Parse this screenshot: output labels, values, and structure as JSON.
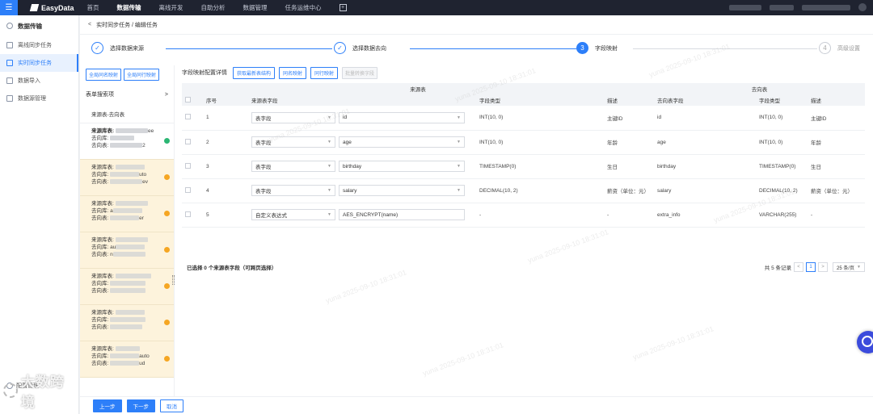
{
  "topbar": {
    "logo": "EasyData",
    "nav": [
      "首页",
      "数据传输",
      "离线开发",
      "自助分析",
      "数据管理",
      "任务运维中心"
    ],
    "active_nav": "数据传输"
  },
  "sidebar": {
    "title": "数据传输",
    "items": [
      {
        "label": "离线同步任务"
      },
      {
        "label": "实时同步任务"
      },
      {
        "label": "数据导入"
      },
      {
        "label": "数据源管理"
      }
    ],
    "bottom": "配置管理"
  },
  "watermark_logo": "大数跨境",
  "watermark_text": "yuna 2025-09-10 18:31:01",
  "breadcrumb": {
    "back": "<",
    "text": "实时同步任务 / 编辑任务"
  },
  "steps": [
    {
      "num": "✓",
      "label": "选择数据来源",
      "state": "done"
    },
    {
      "num": "✓",
      "label": "选择数据去向",
      "state": "done"
    },
    {
      "num": "3",
      "label": "字段映射",
      "state": "current"
    },
    {
      "num": "4",
      "label": "高级设置",
      "state": "todo"
    }
  ],
  "left_panel": {
    "btn_all_same_name": "全局同名映射",
    "btn_all_same_row": "全局同行映射",
    "search_label": "表单搜索项",
    "search_arrow": ">",
    "list_header": "来源表-去向表",
    "cards": [
      {
        "source": "来源库表:",
        "target_lib": "去向库:",
        "target_tbl": "去向表:",
        "tail1": "ee",
        "tail2": "2",
        "status": "ok"
      },
      {
        "source": "来源库表:",
        "target_lib": "去向库:",
        "target_tbl": "去向表:",
        "tail1": "uto",
        "tail2": "ev",
        "status": "warn"
      },
      {
        "source": "来源库表:",
        "target_lib": "去向库:",
        "target_tbl": "去向表:",
        "tail1": "a",
        "tail2": "er",
        "status": "warn"
      },
      {
        "source": "来源库表:",
        "target_lib": "去向库:",
        "target_tbl": "去向表:",
        "tail1": "au",
        "tail2": "n",
        "status": "warn"
      },
      {
        "source": "来源库表:",
        "target_lib": "去向库:",
        "target_tbl": "去向表:",
        "tail1": "",
        "tail2": "",
        "status": "warn"
      },
      {
        "source": "来源库表:",
        "target_lib": "去向库:",
        "target_tbl": "去向表:",
        "tail1": "",
        "tail2": "",
        "status": "warn"
      },
      {
        "source": "来源库表:",
        "target_lib": "去向库:",
        "target_tbl": "去向表:",
        "tail1": "auto",
        "tail2": "ud",
        "status": "warn"
      }
    ]
  },
  "right_panel": {
    "title": "字段映射配置详情",
    "btn_refresh": "获取最新表结构",
    "btn_same_name": "同名映射",
    "btn_same_row": "同行映射",
    "btn_batch": "批量转换字段",
    "group_source": "来源表",
    "group_target": "去向表",
    "headers": [
      "序号",
      "来源表字段",
      "字段类型",
      "描述",
      "去向表字段",
      "字段类型",
      "描述"
    ],
    "rows": [
      {
        "no": "1",
        "kind": "表字段",
        "field": "id",
        "type": "INT(10, 0)",
        "desc": "主键ID",
        "t_field": "id",
        "t_type": "INT(10, 0)",
        "t_desc": "主键ID"
      },
      {
        "no": "2",
        "kind": "表字段",
        "field": "age",
        "type": "INT(10, 0)",
        "desc": "年龄",
        "t_field": "age",
        "t_type": "INT(10, 0)",
        "t_desc": "年龄"
      },
      {
        "no": "3",
        "kind": "表字段",
        "field": "birthday",
        "type": "TIMESTAMP(0)",
        "desc": "生日",
        "t_field": "birthday",
        "t_type": "TIMESTAMP(0)",
        "t_desc": "生日"
      },
      {
        "no": "4",
        "kind": "表字段",
        "field": "salary",
        "type": "DECIMAL(10, 2)",
        "desc": "薪资（单位：元）",
        "t_field": "salary",
        "t_type": "DECIMAL(10, 2)",
        "t_desc": "薪资（单位：元）"
      },
      {
        "no": "5",
        "kind": "自定义表达式",
        "field": "AES_ENCRYPT(name)",
        "type": "-",
        "desc": "-",
        "t_field": "extra_info",
        "t_type": "VARCHAR(255)",
        "t_desc": "-"
      }
    ],
    "footer_selected": "已选择 0 个来源表字段（可跨页选择）",
    "total": "共 5 条记录",
    "page": "1",
    "page_size": "25 条/页"
  },
  "actions": {
    "prev": "上一步",
    "next": "下一步",
    "cancel": "取消"
  }
}
